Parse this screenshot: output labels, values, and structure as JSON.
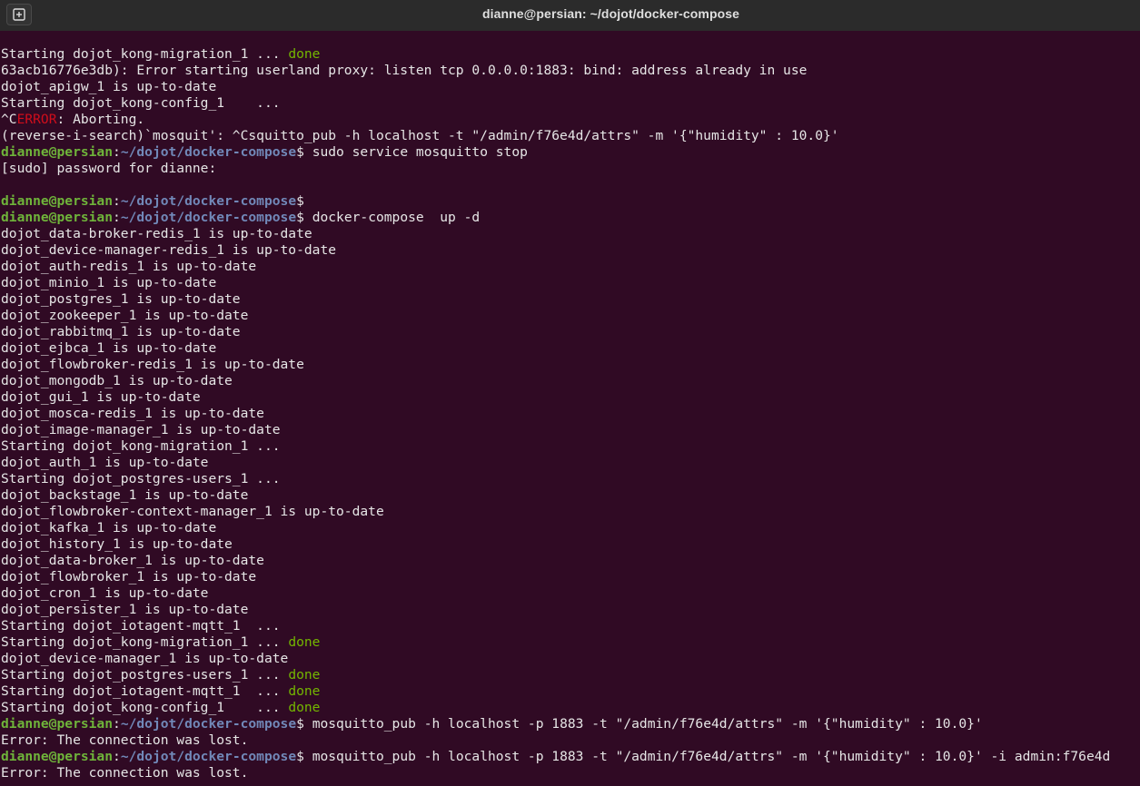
{
  "window": {
    "title": "dianne@persian: ~/dojot/docker-compose",
    "new_tab_icon": "new-tab-icon"
  },
  "prompt": {
    "user_host": "dianne@persian",
    "path": "~/dojot/docker-compose",
    "colon": ":",
    "dollar": "$"
  },
  "lines": [
    {
      "kind": "text",
      "text": "Starting dojot_kong-migration_1 ... ",
      "status": "done"
    },
    {
      "kind": "text",
      "text": "63acb16776e3db): Error starting userland proxy: listen tcp 0.0.0.0:1883: bind: address already in use"
    },
    {
      "kind": "text",
      "text": "dojot_apigw_1 is up-to-date"
    },
    {
      "kind": "text",
      "text": "Starting dojot_kong-config_1    ..."
    },
    {
      "kind": "error",
      "pre": "^C",
      "err": "ERROR",
      "post": ": Aborting."
    },
    {
      "kind": "text",
      "text": "(reverse-i-search)`mosquit': ^Csquitto_pub -h localhost -t \"/admin/f76e4d/attrs\" -m '{\"humidity\" : 10.0}'"
    },
    {
      "kind": "prompt",
      "cmd": " sudo service mosquitto stop"
    },
    {
      "kind": "text",
      "text": "[sudo] password for dianne: "
    },
    {
      "kind": "text",
      "text": ""
    },
    {
      "kind": "prompt",
      "cmd": ""
    },
    {
      "kind": "prompt",
      "cmd": " docker-compose  up -d"
    },
    {
      "kind": "text",
      "text": "dojot_data-broker-redis_1 is up-to-date"
    },
    {
      "kind": "text",
      "text": "dojot_device-manager-redis_1 is up-to-date"
    },
    {
      "kind": "text",
      "text": "dojot_auth-redis_1 is up-to-date"
    },
    {
      "kind": "text",
      "text": "dojot_minio_1 is up-to-date"
    },
    {
      "kind": "text",
      "text": "dojot_postgres_1 is up-to-date"
    },
    {
      "kind": "text",
      "text": "dojot_zookeeper_1 is up-to-date"
    },
    {
      "kind": "text",
      "text": "dojot_rabbitmq_1 is up-to-date"
    },
    {
      "kind": "text",
      "text": "dojot_ejbca_1 is up-to-date"
    },
    {
      "kind": "text",
      "text": "dojot_flowbroker-redis_1 is up-to-date"
    },
    {
      "kind": "text",
      "text": "dojot_mongodb_1 is up-to-date"
    },
    {
      "kind": "text",
      "text": "dojot_gui_1 is up-to-date"
    },
    {
      "kind": "text",
      "text": "dojot_mosca-redis_1 is up-to-date"
    },
    {
      "kind": "text",
      "text": "dojot_image-manager_1 is up-to-date"
    },
    {
      "kind": "text",
      "text": "Starting dojot_kong-migration_1 ..."
    },
    {
      "kind": "text",
      "text": "dojot_auth_1 is up-to-date"
    },
    {
      "kind": "text",
      "text": "Starting dojot_postgres-users_1 ..."
    },
    {
      "kind": "text",
      "text": "dojot_backstage_1 is up-to-date"
    },
    {
      "kind": "text",
      "text": "dojot_flowbroker-context-manager_1 is up-to-date"
    },
    {
      "kind": "text",
      "text": "dojot_kafka_1 is up-to-date"
    },
    {
      "kind": "text",
      "text": "dojot_history_1 is up-to-date"
    },
    {
      "kind": "text",
      "text": "dojot_data-broker_1 is up-to-date"
    },
    {
      "kind": "text",
      "text": "dojot_flowbroker_1 is up-to-date"
    },
    {
      "kind": "text",
      "text": "dojot_cron_1 is up-to-date"
    },
    {
      "kind": "text",
      "text": "dojot_persister_1 is up-to-date"
    },
    {
      "kind": "text",
      "text": "Starting dojot_iotagent-mqtt_1  ..."
    },
    {
      "kind": "text",
      "text": "Starting dojot_kong-migration_1 ... ",
      "status": "done"
    },
    {
      "kind": "text",
      "text": "dojot_device-manager_1 is up-to-date"
    },
    {
      "kind": "text",
      "text": "Starting dojot_postgres-users_1 ... ",
      "status": "done"
    },
    {
      "kind": "text",
      "text": "Starting dojot_iotagent-mqtt_1  ... ",
      "status": "done"
    },
    {
      "kind": "text",
      "text": "Starting dojot_kong-config_1    ... ",
      "status": "done"
    },
    {
      "kind": "prompt",
      "cmd": " mosquitto_pub -h localhost -p 1883 -t \"/admin/f76e4d/attrs\" -m '{\"humidity\" : 10.0}'"
    },
    {
      "kind": "text",
      "text": "Error: The connection was lost."
    },
    {
      "kind": "prompt",
      "cmd": " mosquitto_pub -h localhost -p 1883 -t \"/admin/f76e4d/attrs\" -m '{\"humidity\" : 10.0}' -i admin:f76e4d"
    },
    {
      "kind": "text",
      "text": "Error: The connection was lost."
    }
  ],
  "colors": {
    "background": "#300a24",
    "titlebar": "#2b2b2b",
    "text": "#e6e6e6",
    "done": "#74b700",
    "error": "#d10d1b",
    "prompt_user": "#6fb43a",
    "prompt_path": "#7188b8"
  }
}
